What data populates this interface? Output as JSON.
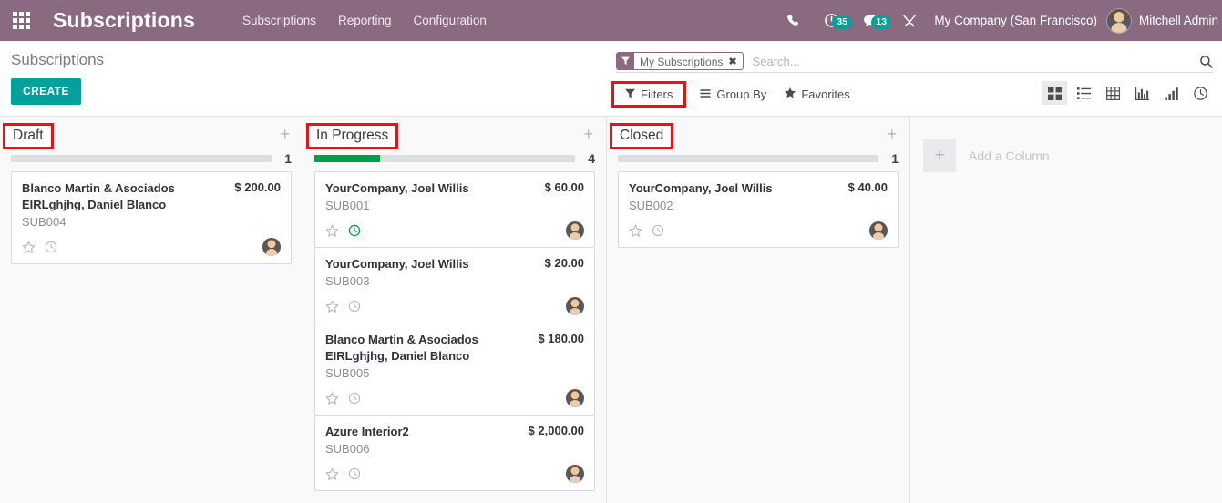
{
  "navbar": {
    "apps_icon": "apps-grid-icon",
    "brand": "Subscriptions",
    "menu": [
      {
        "label": "Subscriptions"
      },
      {
        "label": "Reporting"
      },
      {
        "label": "Configuration"
      }
    ],
    "phone_icon": "phone-icon",
    "activity_icon": "clock-activity-icon",
    "activity_count": "35",
    "messages_icon": "chat-bubble-icon",
    "messages_count": "13",
    "tools_icon": "wrench-tools-icon",
    "company": "My Company (San Francisco)",
    "user": "Mitchell Admin",
    "badge_color": "#00a09d",
    "bar_color": "#8a6a80"
  },
  "control_panel": {
    "breadcrumb": "Subscriptions",
    "create_label": "CREATE",
    "create_color": "#00a09d",
    "search": {
      "facet_icon": "filter-funnel-icon",
      "facet_label": "My Subscriptions",
      "facet_remove": "✖",
      "placeholder": "Search...",
      "value": "",
      "magnify_icon": "search-icon"
    },
    "buttons": {
      "filters_label": "Filters",
      "filters_icon": "filter-funnel-icon",
      "groupby_label": "Group By",
      "groupby_icon": "hamburger-lines-icon",
      "favorites_label": "Favorites",
      "favorites_icon": "star-icon"
    },
    "views": [
      {
        "name": "kanban",
        "active": true
      },
      {
        "name": "list",
        "active": false
      },
      {
        "name": "pivot",
        "active": false
      },
      {
        "name": "graph-bar",
        "active": false
      },
      {
        "name": "graph-ascending",
        "active": false
      },
      {
        "name": "cohort-clock",
        "active": false
      }
    ]
  },
  "kanban": {
    "add_column": {
      "plus": "+",
      "label": "Add a Column"
    },
    "columns": [
      {
        "title": "Draft",
        "highlighted": true,
        "plus": "+",
        "count": "1",
        "progress_percent": 0,
        "shaded": false,
        "cards": [
          {
            "name": "Blanco Martin & Asociados EIRLghjhg, Daniel Blanco",
            "price": "$ 200.00",
            "reference": "SUB004",
            "star": "☆",
            "activity_state": "gray"
          }
        ]
      },
      {
        "title": "In Progress",
        "highlighted": true,
        "plus": "+",
        "count": "4",
        "progress_percent": 25,
        "shaded": false,
        "cards": [
          {
            "name": "YourCompany, Joel Willis",
            "price": "$ 60.00",
            "reference": "SUB001",
            "star": "☆",
            "activity_state": "green"
          },
          {
            "name": "YourCompany, Joel Willis",
            "price": "$ 20.00",
            "reference": "SUB003",
            "star": "☆",
            "activity_state": "gray"
          },
          {
            "name": "Blanco Martin & Asociados EIRLghjhg, Daniel Blanco",
            "price": "$ 180.00",
            "reference": "SUB005",
            "star": "☆",
            "activity_state": "gray"
          },
          {
            "name": "Azure Interior2",
            "price": "$ 2,000.00",
            "reference": "SUB006",
            "star": "☆",
            "activity_state": "gray"
          }
        ]
      },
      {
        "title": "Closed",
        "highlighted": true,
        "plus": "+",
        "count": "1",
        "progress_percent": 0,
        "shaded": false,
        "cards": [
          {
            "name": "YourCompany, Joel Willis",
            "price": "$ 40.00",
            "reference": "SUB002",
            "star": "☆",
            "activity_state": "gray"
          }
        ]
      }
    ]
  }
}
